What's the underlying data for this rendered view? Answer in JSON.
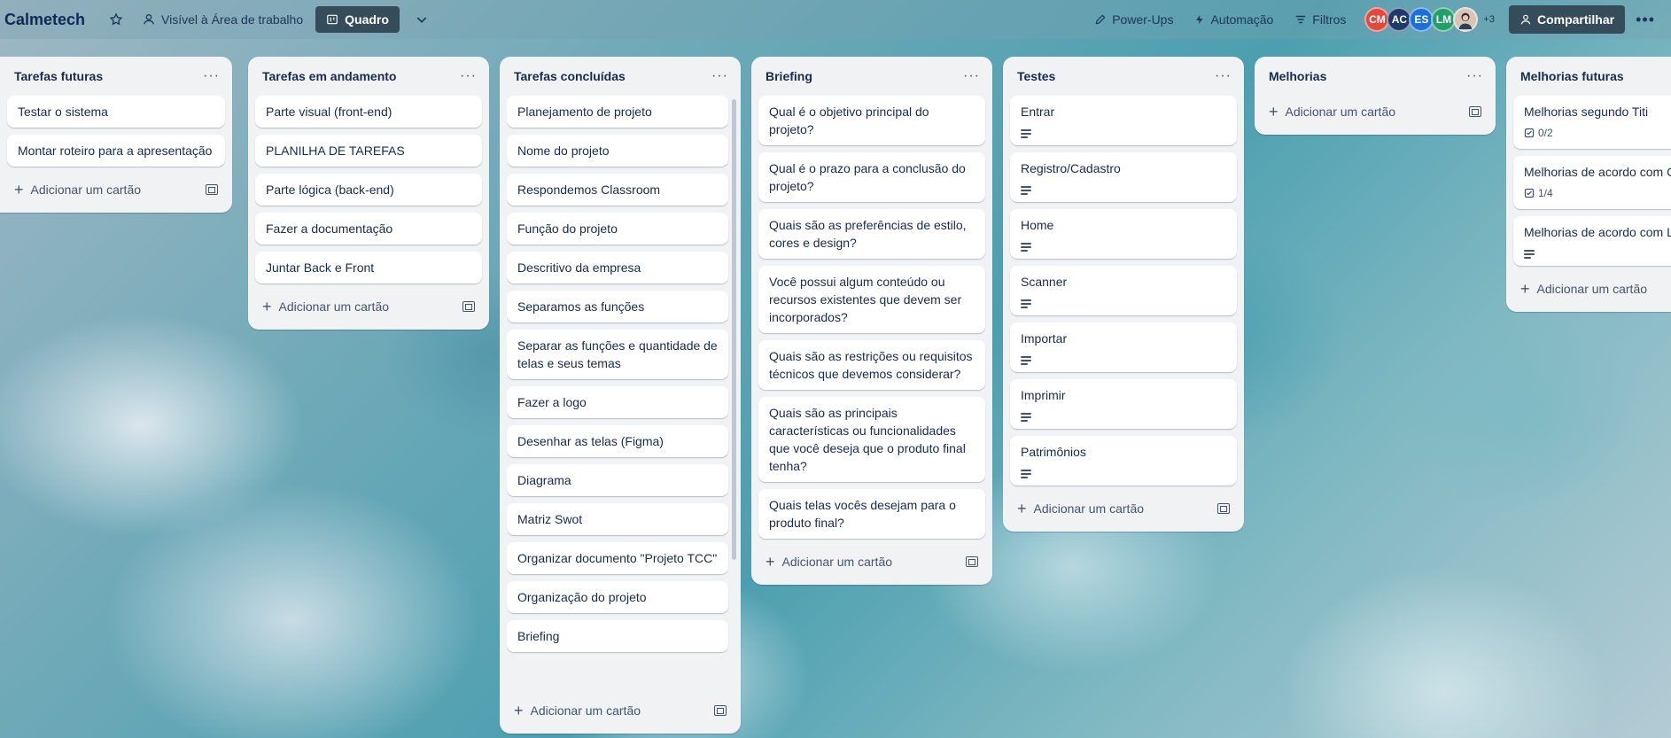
{
  "header": {
    "board_title": "Calmetech",
    "star_icon": "star-icon",
    "visibility_label": "Visível à Área de trabalho",
    "view_label": "Quadro",
    "powerups_label": "Power-Ups",
    "automation_label": "Automação",
    "filters_label": "Filtros",
    "avatars": [
      {
        "initials": "CM",
        "color": "#e2483d"
      },
      {
        "initials": "AC",
        "color": "#1f3a68"
      },
      {
        "initials": "ES",
        "color": "#1d6fd8"
      },
      {
        "initials": "LM",
        "color": "#22a06b"
      }
    ],
    "more_members": "+3",
    "share_label": "Compartilhar"
  },
  "add_card_label": "Adicionar um cartão",
  "lists": [
    {
      "title": "Tarefas futuras",
      "cards": [
        {
          "text": "Testar o sistema"
        },
        {
          "text": "Montar roteiro para a apresentação"
        }
      ]
    },
    {
      "title": "Tarefas em andamento",
      "cards": [
        {
          "text": "Parte visual (front-end)"
        },
        {
          "text": "PLANILHA DE TAREFAS"
        },
        {
          "text": "Parte lógica (back-end)"
        },
        {
          "text": "Fazer a documentação"
        },
        {
          "text": "Juntar Back e Front"
        }
      ]
    },
    {
      "title": "Tarefas concluídas",
      "cards": [
        {
          "text": "Planejamento de projeto"
        },
        {
          "text": "Nome do projeto"
        },
        {
          "text": "Respondemos Classroom"
        },
        {
          "text": "Função do projeto"
        },
        {
          "text": "Descritivo da empresa"
        },
        {
          "text": "Separamos as funções"
        },
        {
          "text": "Separar as funções e quantidade de telas e seus temas"
        },
        {
          "text": "Fazer a logo"
        },
        {
          "text": "Desenhar as telas (Figma)"
        },
        {
          "text": "Diagrama"
        },
        {
          "text": "Matriz Swot"
        },
        {
          "text": "Organizar documento \"Projeto TCC\""
        },
        {
          "text": "Organização do projeto"
        },
        {
          "text": "Briefing"
        }
      ]
    },
    {
      "title": "Briefing",
      "cards": [
        {
          "text": "Qual é o objetivo principal do projeto?"
        },
        {
          "text": "Qual é o prazo para a conclusão do projeto?"
        },
        {
          "text": "Quais são as preferências de estilo, cores e design?"
        },
        {
          "text": "Você possui algum conteúdo ou recursos existentes que devem ser incorporados?"
        },
        {
          "text": "Quais são as restrições ou requisitos técnicos que devemos considerar?"
        },
        {
          "text": "Quais são as principais características ou funcionalidades que você deseja que o produto final tenha?"
        },
        {
          "text": "Quais telas vocês desejam para o produto final?"
        }
      ]
    },
    {
      "title": "Testes",
      "cards": [
        {
          "text": "Entrar",
          "description_icon": "description-icon"
        },
        {
          "text": "Registro/Cadastro",
          "description_icon": "description-icon"
        },
        {
          "text": "Home",
          "description_icon": "description-icon"
        },
        {
          "text": "Scanner",
          "description_icon": "description-icon"
        },
        {
          "text": "Importar",
          "description_icon": "description-icon"
        },
        {
          "text": "Imprimir",
          "description_icon": "description-icon"
        },
        {
          "text": "Patrimônios",
          "description_icon": "description-icon"
        }
      ]
    },
    {
      "title": "Melhorias",
      "cards": []
    },
    {
      "title": "Melhorias futuras",
      "cards": [
        {
          "text": "Melhorias segundo Titi",
          "checklist": "0/2"
        },
        {
          "text": "Melhorias de acordo com C",
          "checklist": "1/4"
        },
        {
          "text": "Melhorias de acordo com L",
          "description_icon": "description-icon"
        }
      ]
    }
  ]
}
